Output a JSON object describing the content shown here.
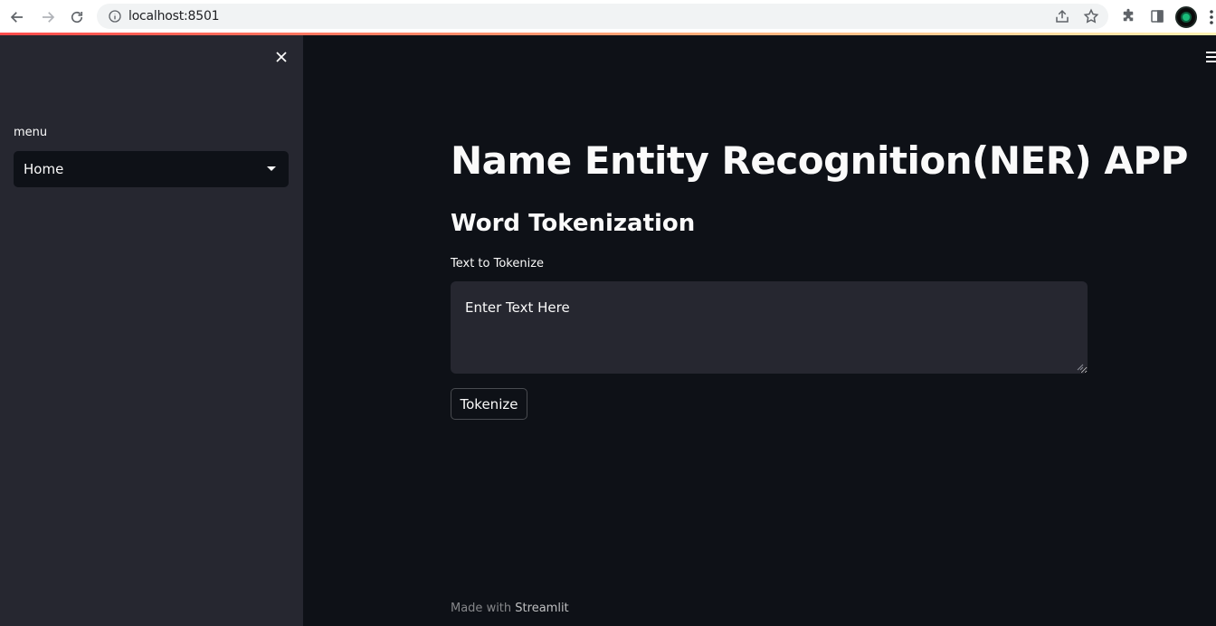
{
  "browser": {
    "url": "localhost:8501",
    "icons": [
      "back-arrow-icon",
      "forward-arrow-icon",
      "reload-icon",
      "info-icon",
      "share-icon",
      "star-icon",
      "extensions-icon",
      "side-panel-icon",
      "profile-avatar",
      "kebab-menu-icon"
    ]
  },
  "colors": {
    "app_background": "#0e1117",
    "sidebar_background": "#262730",
    "text": "#fafafa",
    "accent_gradient": [
      "#ff4b4b",
      "#fff2b3"
    ]
  },
  "sidebar": {
    "menu_label": "menu",
    "select": {
      "value": "Home"
    }
  },
  "main": {
    "title": "Name Entity Recognition(NER) APP",
    "section_heading": "Word Tokenization",
    "text_field": {
      "label": "Text to Tokenize",
      "placeholder": "Enter Text Here"
    },
    "button_label": "Tokenize"
  },
  "footer": {
    "prefix": "Made with",
    "brand": "Streamlit"
  }
}
